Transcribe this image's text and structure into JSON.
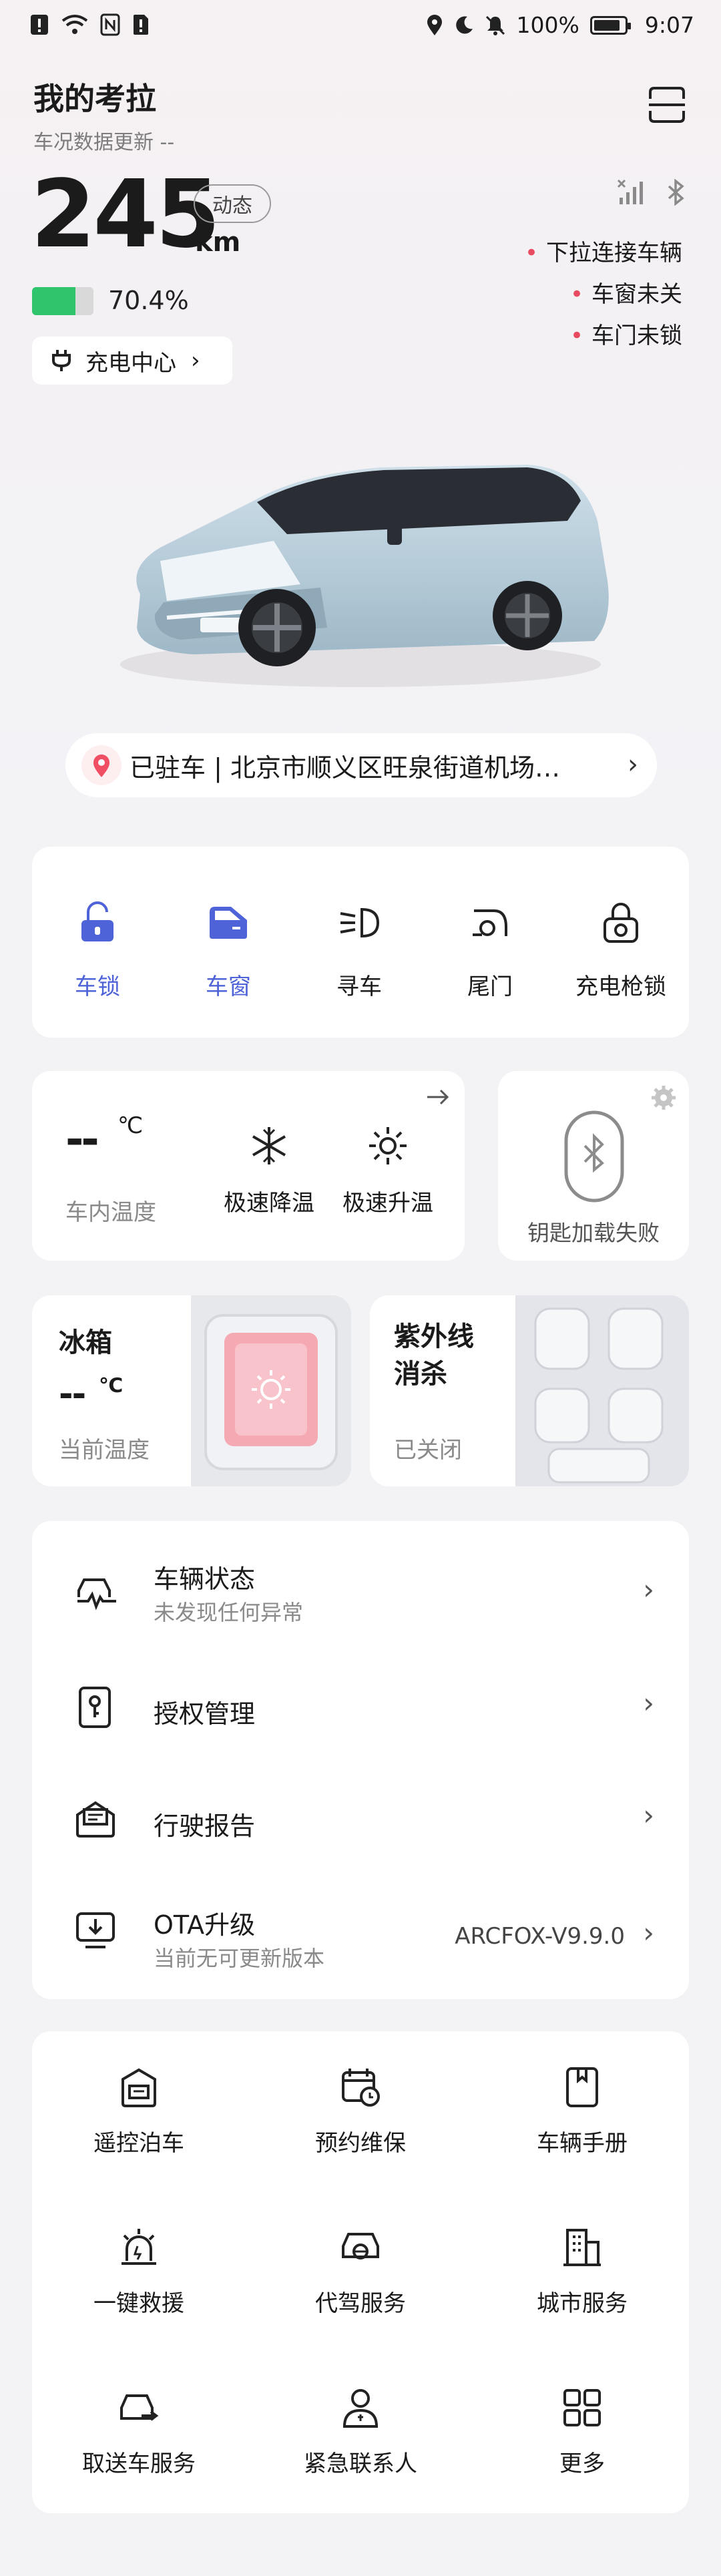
{
  "status_bar": {
    "battery_pct": "100%",
    "time": "9:07"
  },
  "header": {
    "title": "我的考拉",
    "subtitle": "车况数据更新 --"
  },
  "range": {
    "value": "245",
    "unit": "km",
    "badge": "动态",
    "battery_pct": "70.4%",
    "battery_fraction": 0.704,
    "charge_button": "充电中心"
  },
  "connection": {
    "items": [
      "下拉连接车辆",
      "车窗未关",
      "车门未锁"
    ]
  },
  "location": {
    "text": "已驻车 | 北京市顺义区旺泉街道机场…"
  },
  "controls": [
    {
      "label": "车锁",
      "icon": "unlock-icon",
      "active": true
    },
    {
      "label": "车窗",
      "icon": "car-window-icon",
      "active": true
    },
    {
      "label": "寻车",
      "icon": "headlight-icon",
      "active": false
    },
    {
      "label": "尾门",
      "icon": "tailgate-icon",
      "active": false
    },
    {
      "label": "充电枪锁",
      "icon": "charger-lock-icon",
      "active": false
    }
  ],
  "climate": {
    "temp_value": "--",
    "temp_unit": "℃",
    "temp_label": "车内温度",
    "cool_label": "极速降温",
    "heat_label": "极速升温"
  },
  "key": {
    "label": "钥匙加载失败"
  },
  "fridge": {
    "title": "冰箱",
    "value": "--",
    "unit": "℃",
    "label": "当前温度"
  },
  "uv": {
    "title_line1": "紫外线",
    "title_line2": "消杀",
    "status": "已关闭"
  },
  "list": [
    {
      "title": "车辆状态",
      "sub": "未发现任何异常",
      "value": ""
    },
    {
      "title": "授权管理",
      "sub": "",
      "value": ""
    },
    {
      "title": "行驶报告",
      "sub": "",
      "value": ""
    },
    {
      "title": "OTA升级",
      "sub": "当前无可更新版本",
      "value": "ARCFOX-V9.9.0"
    }
  ],
  "services": [
    {
      "label": "遥控泊车",
      "icon": "remote-park-icon"
    },
    {
      "label": "预约维保",
      "icon": "calendar-clock-icon"
    },
    {
      "label": "车辆手册",
      "icon": "manual-icon"
    },
    {
      "label": "一键救援",
      "icon": "rescue-icon"
    },
    {
      "label": "代驾服务",
      "icon": "driver-icon"
    },
    {
      "label": "城市服务",
      "icon": "city-icon"
    },
    {
      "label": "取送车服务",
      "icon": "car-pickup-icon"
    },
    {
      "label": "紧急联系人",
      "icon": "contact-icon"
    },
    {
      "label": "更多",
      "icon": "more-grid-icon"
    }
  ],
  "colors": {
    "accent": "#4f63d8",
    "battery": "#2fc56d",
    "alert_dot": "#e84a5f"
  }
}
